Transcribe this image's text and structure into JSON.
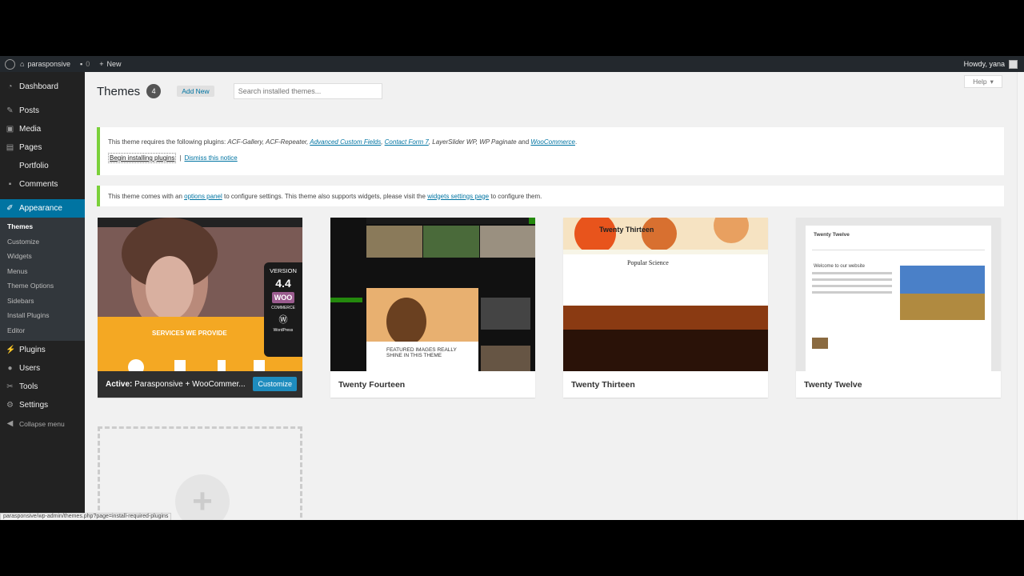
{
  "adminbar": {
    "site_name": "parasponsive",
    "comments": "0",
    "new_label": "New",
    "howdy": "Howdy, yana"
  },
  "sidebar": {
    "items": [
      {
        "label": "Dashboard",
        "icon": "dashboard-icon"
      },
      {
        "label": "Posts",
        "icon": "pin-icon"
      },
      {
        "label": "Media",
        "icon": "media-icon"
      },
      {
        "label": "Pages",
        "icon": "pages-icon"
      },
      {
        "label": "Portfolio",
        "icon": "portfolio-icon"
      },
      {
        "label": "Comments",
        "icon": "comments-icon"
      },
      {
        "label": "Appearance",
        "icon": "brush-icon"
      }
    ],
    "appearance_sub": [
      "Themes",
      "Customize",
      "Widgets",
      "Menus",
      "Theme Options",
      "Sidebars",
      "Install Plugins",
      "Editor"
    ],
    "items_after": [
      {
        "label": "Plugins",
        "icon": "plugin-icon"
      },
      {
        "label": "Users",
        "icon": "users-icon"
      },
      {
        "label": "Tools",
        "icon": "tools-icon"
      },
      {
        "label": "Settings",
        "icon": "settings-icon"
      }
    ],
    "collapse_label": "Collapse menu"
  },
  "header": {
    "title": "Themes",
    "count": "4",
    "add_new": "Add New",
    "search_placeholder": "Search installed themes...",
    "help": "Help"
  },
  "notice1": {
    "text_before": "This theme requires the following plugins: ",
    "plugins_plain": "ACF-Gallery, ACF-Repeater, ",
    "link1": "Advanced Custom Fields",
    "sep1": ", ",
    "link2": "Contact Form 7",
    "plugins_plain2": ", LayerSlider WP, WP Paginate",
    "and": " and ",
    "link3": "WooCommerce",
    "end": ".",
    "action1": "Begin installing plugins",
    "sep": "|",
    "action2": "Dismiss this notice"
  },
  "notice2": {
    "text1": "This theme comes with an ",
    "link1": "options panel",
    "text2": " to configure settings. This theme also supports widgets, please visit the ",
    "link2": "widgets settings page",
    "text3": " to configure them."
  },
  "themes": [
    {
      "active_label": "Active:",
      "name": "Parasponsive + WooCommer...",
      "button": "Customize",
      "version_label": "VERSION",
      "version": "4.4",
      "woo": "WOO",
      "woo_sub": "COMMERCE",
      "wp": "WordPress",
      "services": "SERVICES WE PROVIDE"
    },
    {
      "name": "Twenty Fourteen",
      "headline": "FEATURED IMAGES REALLY SHINE IN THIS THEME"
    },
    {
      "name": "Twenty Thirteen",
      "site_title": "Twenty Thirteen",
      "post_title": "Popular Science"
    },
    {
      "name": "Twenty Twelve",
      "site_title": "Twenty Twelve",
      "welcome": "Welcome to our website"
    }
  ],
  "status_url": "parasponsive/wp-admin/themes.php?page=install-required-plugins",
  "colors": {
    "adminbar": "#23282d",
    "sidebar": "#222222",
    "accent": "#0074a2",
    "notice_border": "#7ad03a"
  }
}
